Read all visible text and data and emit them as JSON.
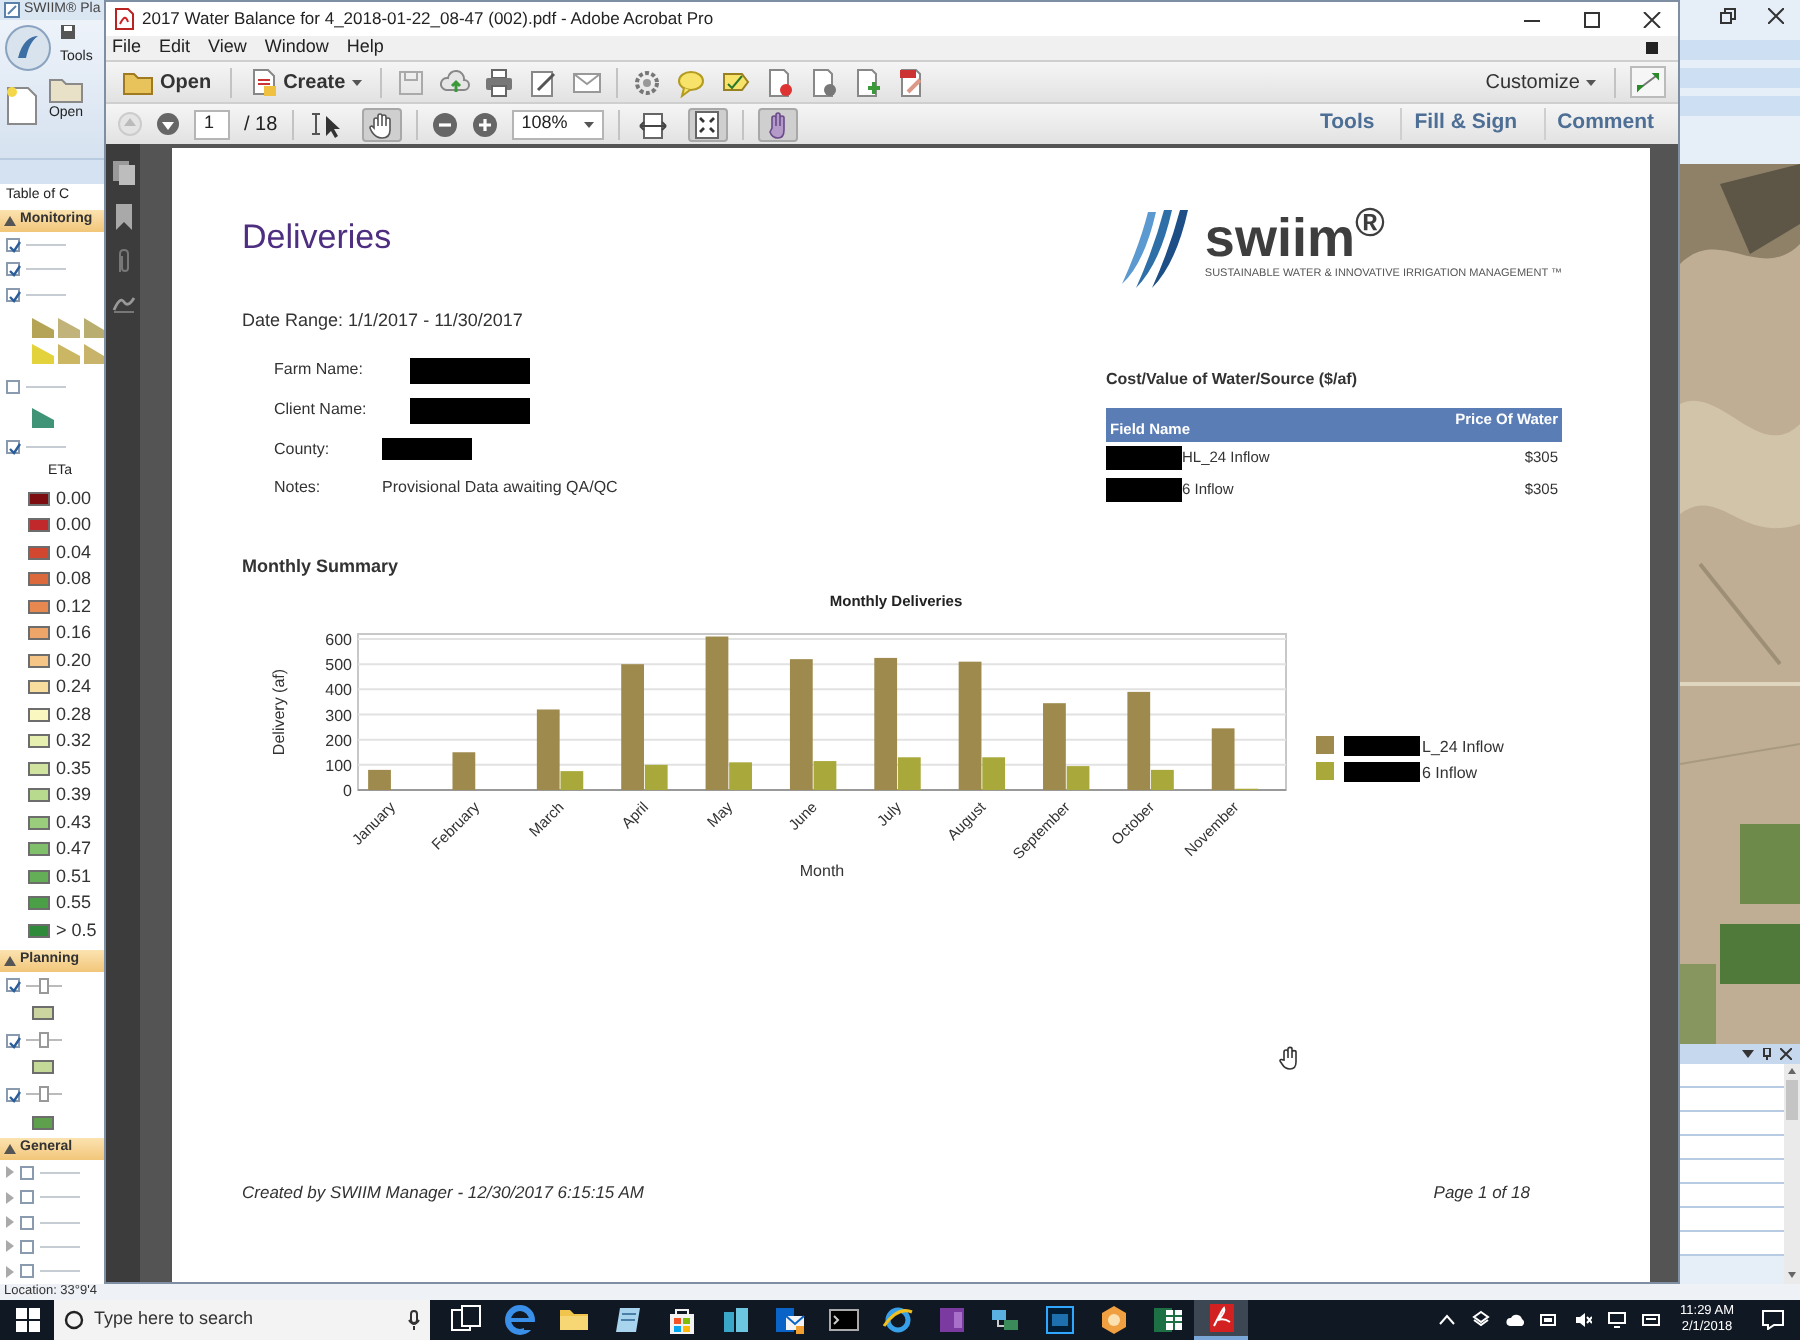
{
  "swiim_app": {
    "title": "SWIIM® Pla",
    "ribbon_tab": "Tools",
    "ribbon_button": "Open",
    "panel_title": "Table of C",
    "monitoring": {
      "title": "Monitoring",
      "layers": [
        {
          "kind": "row",
          "checked": true
        },
        {
          "kind": "row",
          "checked": true
        },
        {
          "kind": "fields",
          "checked": true
        },
        {
          "kind": "polygon",
          "checked": false
        },
        {
          "kind": "row",
          "checked": true
        }
      ],
      "legend_title": "ETa",
      "legend": [
        {
          "label": "0.00",
          "color": "#7d0c10"
        },
        {
          "label": "0.00",
          "color": "#c0282c"
        },
        {
          "label": "0.04",
          "color": "#d2472f"
        },
        {
          "label": "0.08",
          "color": "#dc693c"
        },
        {
          "label": "0.12",
          "color": "#e6884f"
        },
        {
          "label": "0.16",
          "color": "#eea56a"
        },
        {
          "label": "0.20",
          "color": "#f5c487"
        },
        {
          "label": "0.24",
          "color": "#f9dd9e"
        },
        {
          "label": "0.28",
          "color": "#fbf7c0"
        },
        {
          "label": "0.32",
          "color": "#e6efb0"
        },
        {
          "label": "0.35",
          "color": "#d0e4a0"
        },
        {
          "label": "0.39",
          "color": "#b8da8e"
        },
        {
          "label": "0.43",
          "color": "#9bce7c"
        },
        {
          "label": "0.47",
          "color": "#80c06a"
        },
        {
          "label": "0.51",
          "color": "#63ae57"
        },
        {
          "label": "0.55",
          "color": "#4b9f46"
        },
        {
          "label": "> 0.5",
          "color": "#2f8b39"
        }
      ]
    },
    "planning": {
      "title": "Planning",
      "layers": [
        {
          "checked": true,
          "color": "#ccd5a0"
        },
        {
          "checked": true,
          "color": "#c4d898"
        },
        {
          "checked": true,
          "color": "#5fa04c"
        }
      ]
    },
    "general": {
      "title": "General",
      "layers": [
        {
          "checked": false
        },
        {
          "checked": false
        },
        {
          "checked": false
        },
        {
          "checked": false
        },
        {
          "checked": false
        }
      ]
    },
    "status": "Location: 33°9'4"
  },
  "acrobat": {
    "title": "2017 Water Balance for 4_2018-01-22_08-47 (002).pdf - Adobe Acrobat Pro",
    "menu": [
      "File",
      "Edit",
      "View",
      "Window",
      "Help"
    ],
    "open": "Open",
    "create": "Create",
    "customize": "Customize",
    "page": "1",
    "page_total": "/ 18",
    "zoom": "108%",
    "page_tools": [
      {
        "kind": "select",
        "selected": false
      },
      {
        "kind": "hand",
        "selected": true
      }
    ],
    "view_tools": [
      {
        "kind": "fit-width",
        "selected": false
      },
      {
        "kind": "fit-page",
        "selected": true
      },
      {
        "kind": "touch",
        "selected": true
      }
    ],
    "panes": [
      "Tools",
      "Fill & Sign",
      "Comment"
    ]
  },
  "document": {
    "title": "Deliveries",
    "logo": {
      "name": "swiim$^{®}$",
      "tagline": "SUSTAINABLE WATER & INNOVATIVE IRRIGATION MANAGEMENT ™"
    },
    "date_range": "Date Range: 1/1/2017 - 11/30/2017",
    "details": [
      {
        "label": "Farm Name:",
        "redacted": true
      },
      {
        "label": "Client Name:",
        "redacted": true
      },
      {
        "label": "County:",
        "redacted": true
      },
      {
        "label": "Notes:",
        "value": "Provisional Data awaiting QA/QC"
      }
    ],
    "cost_table": {
      "title": "Cost/Value of Water/Source ($/af)",
      "columns": [
        "Field Name",
        "Price Of Water"
      ],
      "rows": [
        {
          "field": "HL_24 Inflow",
          "redacted": true,
          "price": "$305"
        },
        {
          "field": "6 Inflow",
          "redacted": true,
          "price": "$305"
        }
      ]
    },
    "summary_title": "Monthly Summary",
    "legend_redacted": true,
    "chart_data": {
      "type": "bar",
      "title": "Monthly Deliveries",
      "xlabel": "Month",
      "ylabel": "Delivery (af)",
      "categories": [
        "January",
        "February",
        "March",
        "April",
        "May",
        "June",
        "July",
        "August",
        "September",
        "October",
        "November"
      ],
      "series": [
        {
          "name": "L_24 Inflow",
          "color": "#9e8a4c",
          "values": [
            80,
            150,
            320,
            500,
            610,
            520,
            525,
            510,
            345,
            390,
            245
          ]
        },
        {
          "name": "6 Inflow",
          "color": "#a9a83a",
          "values": [
            0,
            0,
            75,
            100,
            110,
            115,
            130,
            130,
            95,
            80,
            5
          ]
        }
      ],
      "ylim": [
        0,
        620
      ],
      "yticks": [
        0,
        100,
        200,
        300,
        400,
        500,
        600
      ],
      "grid": true
    },
    "footer_left": "Created by SWIIM Manager - 12/30/2017 6:15:15 AM",
    "footer_right": "Page 1 of 18"
  },
  "taskbar": {
    "search_placeholder": "Type here to search",
    "apps": [
      {
        "kind": "task-view",
        "selected": false
      },
      {
        "kind": "browser",
        "selected": false
      },
      {
        "kind": "folder",
        "selected": false
      },
      {
        "kind": "notepad",
        "selected": false
      },
      {
        "kind": "store",
        "selected": false
      },
      {
        "kind": "app",
        "selected": false
      },
      {
        "kind": "mail",
        "selected": false
      },
      {
        "kind": "terminal",
        "selected": false
      },
      {
        "kind": "globe",
        "selected": false
      },
      {
        "kind": "notebook",
        "selected": false
      },
      {
        "kind": "network",
        "selected": false
      },
      {
        "kind": "image-editor",
        "selected": false
      },
      {
        "kind": "hexagon",
        "selected": false
      },
      {
        "kind": "spreadsheet",
        "selected": false
      },
      {
        "kind": "pdf",
        "selected": true
      }
    ],
    "time": "11:29 AM",
    "date": "2/1/2018"
  }
}
